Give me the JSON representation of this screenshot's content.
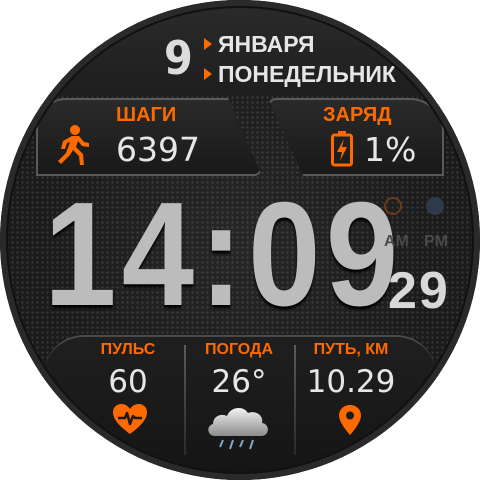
{
  "date": {
    "day": "9",
    "month": "ЯНВАРЯ",
    "weekday": "ПОНЕДЕЛЬНИК"
  },
  "steps": {
    "label": "ШАГИ",
    "value": "6397",
    "icon": "running-man-icon"
  },
  "battery": {
    "label": "ЗАРЯД",
    "value": "1%",
    "icon": "battery-charging-icon"
  },
  "time": {
    "hours_minutes": "14:09",
    "seconds": "29",
    "am": "AM",
    "pm": "PM"
  },
  "bottom": {
    "pulse": {
      "label": "ПУЛЬС",
      "value": "60",
      "icon": "heart-rate-icon"
    },
    "weather": {
      "label": "ПОГОДА",
      "value": "26°",
      "icon": "rain-cloud-icon"
    },
    "distance": {
      "label": "ПУТЬ, КМ",
      "value": "10.29",
      "icon": "location-pin-icon"
    }
  },
  "colors": {
    "accent": "#ff6a00",
    "text": "#e6e6e6",
    "time": "#bcbcbc",
    "background": "#1b1b1b"
  }
}
